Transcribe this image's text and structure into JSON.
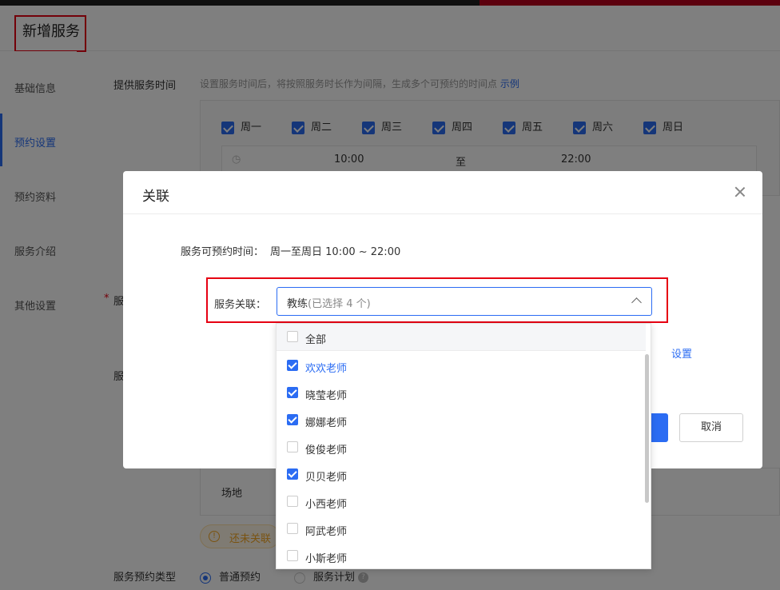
{
  "page": {
    "title": "新增服务"
  },
  "leftnav": {
    "items": [
      {
        "label": "基础信息"
      },
      {
        "label": "预约设置"
      },
      {
        "label": "预约资料"
      },
      {
        "label": "服务介绍"
      },
      {
        "label": "其他设置"
      }
    ],
    "active_index": 1
  },
  "background": {
    "service_time_label": "提供服务时间",
    "service_time_hint": "设置服务时间后，将按照服务时长作为间隔，生成多个可预约的时间点",
    "example_link": "示例",
    "weekdays": [
      {
        "label": "周一",
        "checked": true
      },
      {
        "label": "周二",
        "checked": true
      },
      {
        "label": "周三",
        "checked": true
      },
      {
        "label": "周四",
        "checked": true
      },
      {
        "label": "周五",
        "checked": true
      },
      {
        "label": "周六",
        "checked": true
      },
      {
        "label": "周日",
        "checked": true
      }
    ],
    "time_start": "10:00",
    "time_sep": "至",
    "time_end": "22:00",
    "required_star": "*",
    "partial_label_1": "服",
    "partial_label_2": "服",
    "venue_label": "场地",
    "warning_text": "还未关联",
    "booking_type_label": "服务预约类型",
    "booking_types": [
      {
        "label": "普通预约",
        "selected": true
      },
      {
        "label": "服务计划",
        "selected": false
      }
    ]
  },
  "modal": {
    "title": "关联",
    "available_time_label": "服务可预约时间：",
    "available_time_value": "周一至周日 10:00 ~ 22:00",
    "assoc_label": "服务关联：",
    "select_value": "教练",
    "select_count": "(已选择 4 个)",
    "settings_link": "设置",
    "cancel_label": "取消"
  },
  "dropdown": {
    "all_label": "全部",
    "all_checked": false,
    "options": [
      {
        "label": "欢欢老师",
        "checked": true,
        "highlighted": true
      },
      {
        "label": "晓莹老师",
        "checked": true,
        "highlighted": false
      },
      {
        "label": "娜娜老师",
        "checked": true,
        "highlighted": false
      },
      {
        "label": "俊俊老师",
        "checked": false,
        "highlighted": false
      },
      {
        "label": "贝贝老师",
        "checked": true,
        "highlighted": false
      },
      {
        "label": "小西老师",
        "checked": false,
        "highlighted": false
      },
      {
        "label": "阿武老师",
        "checked": false,
        "highlighted": false
      },
      {
        "label": "小斯老师",
        "checked": false,
        "highlighted": false
      }
    ]
  },
  "colors": {
    "primary": "#2b6cf3",
    "highlight_border": "#e60012",
    "warning": "#f5a623"
  }
}
